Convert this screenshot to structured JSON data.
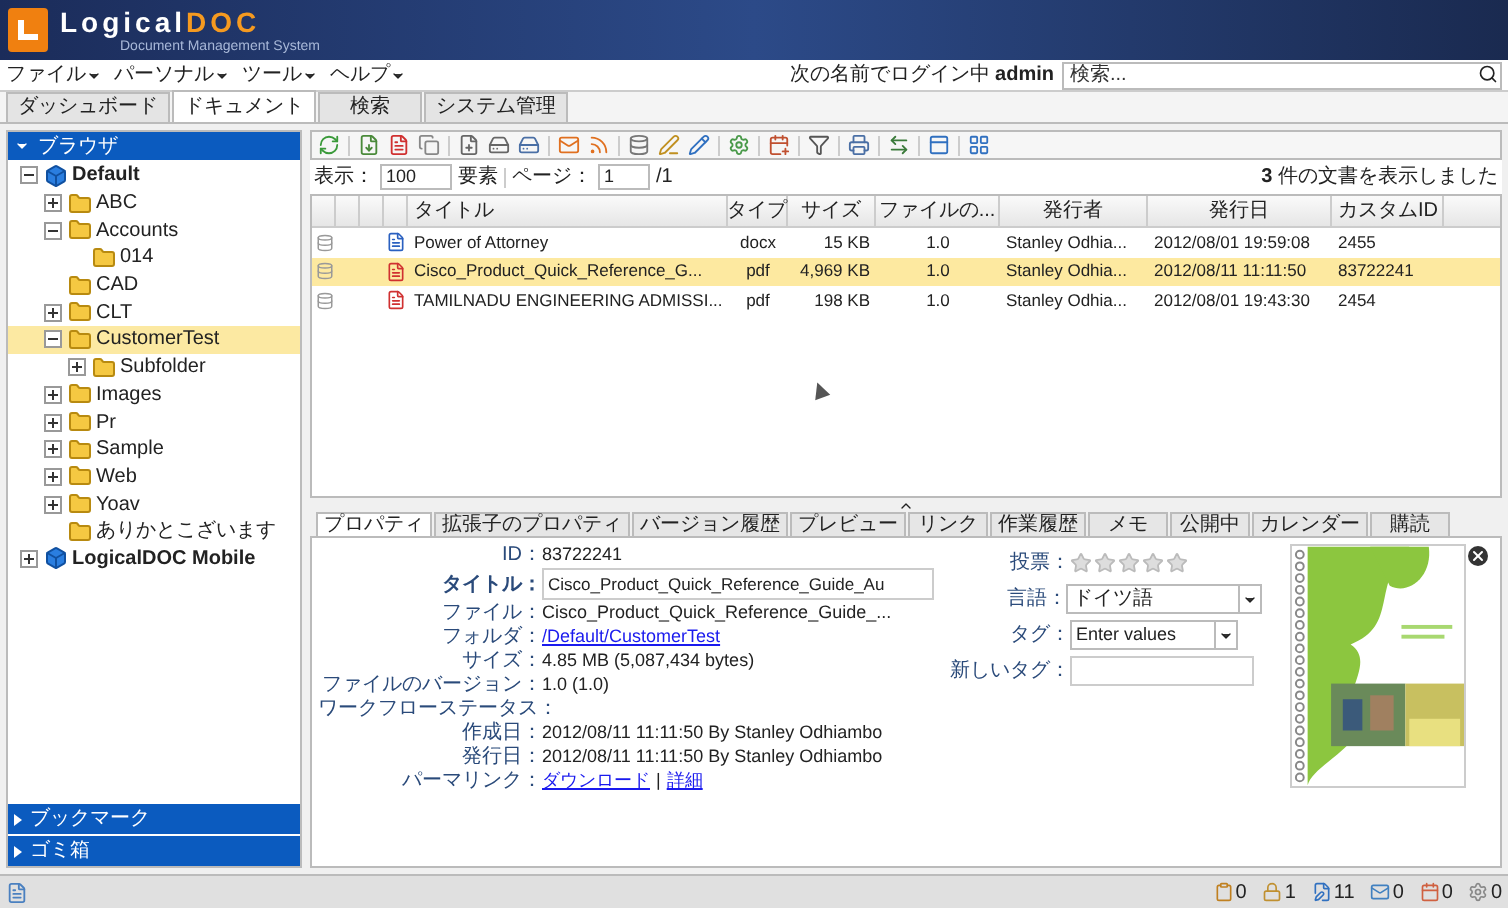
{
  "header": {
    "logo_main": "Logical",
    "logo_accent": "DOC",
    "subtitle": "Document Management System"
  },
  "menus": [
    {
      "label": "ファイル"
    },
    {
      "label": "パーソナル"
    },
    {
      "label": "ツール"
    },
    {
      "label": "ヘルプ"
    }
  ],
  "login": {
    "prefix": "次の名前でログイン中",
    "user": "admin"
  },
  "search": {
    "placeholder": "検索..."
  },
  "main_tabs": [
    {
      "label": "ダッシュボード",
      "selected": false
    },
    {
      "label": "ドキュメント",
      "selected": true
    },
    {
      "label": "検索",
      "selected": false
    },
    {
      "label": "システム管理",
      "selected": false
    }
  ],
  "browser": {
    "title": "ブラウザ",
    "tree": [
      {
        "label": "Default",
        "kind": "workspace",
        "expanded": true,
        "selected": false,
        "children": [
          {
            "label": "ABC",
            "kind": "folder",
            "expanded": false,
            "selected": false
          },
          {
            "label": "Accounts",
            "kind": "folder",
            "expanded": true,
            "selected": false,
            "children": [
              {
                "label": "014",
                "kind": "folder",
                "selected": false
              }
            ]
          },
          {
            "label": "CAD",
            "kind": "folder",
            "selected": false
          },
          {
            "label": "CLT",
            "kind": "folder",
            "expanded": false,
            "selected": false
          },
          {
            "label": "CustomerTest",
            "kind": "folder",
            "expanded": true,
            "selected": true,
            "children": [
              {
                "label": "Subfolder",
                "kind": "folder",
                "expanded": false,
                "selected": false
              }
            ]
          },
          {
            "label": "Images",
            "kind": "folder",
            "expanded": false,
            "selected": false
          },
          {
            "label": "Pr",
            "kind": "folder",
            "expanded": false,
            "selected": false
          },
          {
            "label": "Sample",
            "kind": "folder",
            "expanded": false,
            "selected": false
          },
          {
            "label": "Web",
            "kind": "folder",
            "expanded": false,
            "selected": false
          },
          {
            "label": "Yoav",
            "kind": "folder",
            "expanded": false,
            "selected": false
          },
          {
            "label": "ありかとこざいます",
            "kind": "folder",
            "selected": false
          }
        ]
      },
      {
        "label": "LogicalDOC Mobile",
        "kind": "workspace",
        "expanded": false,
        "selected": false
      }
    ]
  },
  "side_sections": [
    {
      "label": "ブックマーク"
    },
    {
      "label": "ゴミ箱"
    }
  ],
  "pager": {
    "show_label": "表示：",
    "page_size": "100",
    "unit": "要素",
    "page_label": "ページ：",
    "page": "1",
    "total": "/1"
  },
  "result_count": {
    "number": "3",
    "text": "件の文書を表示しました"
  },
  "table": {
    "columns": [
      "タイトル",
      "タイプ",
      "サイズ",
      "ファイルの...",
      "発行者",
      "発行日",
      "カスタムID"
    ],
    "rows": [
      {
        "kind": "docx",
        "selected": false,
        "cells": [
          "Power of Attorney",
          "docx",
          "15 KB",
          "1.0",
          "Stanley Odhia...",
          "2012/08/01 19:59:08",
          "2455"
        ]
      },
      {
        "kind": "pdf",
        "selected": true,
        "cells": [
          "Cisco_Product_Quick_Reference_G...",
          "pdf",
          "4,969 KB",
          "1.0",
          "Stanley Odhia...",
          "2012/08/11 11:11:50",
          "83722241"
        ]
      },
      {
        "kind": "pdf",
        "selected": false,
        "cells": [
          "TAMILNADU ENGINEERING ADMISSI...",
          "pdf",
          "198 KB",
          "1.0",
          "Stanley Odhia...",
          "2012/08/01 19:43:30",
          "2454"
        ]
      }
    ]
  },
  "detail_tabs": [
    {
      "label": "プロパティ",
      "selected": true
    },
    {
      "label": "拡張子のプロパティ",
      "selected": false
    },
    {
      "label": "バージョン履歴",
      "selected": false
    },
    {
      "label": "プレビュー",
      "selected": false
    },
    {
      "label": "リンク",
      "selected": false
    },
    {
      "label": "作業履歴",
      "selected": false
    },
    {
      "label": "メモ",
      "selected": false
    },
    {
      "label": "公開中",
      "selected": false
    },
    {
      "label": "カレンダー",
      "selected": false
    },
    {
      "label": "購読",
      "selected": false
    }
  ],
  "properties": [
    {
      "kind": "text",
      "label": "ID：",
      "value": "83722241"
    },
    {
      "kind": "field",
      "label": "タイトル：",
      "value": "Cisco_Product_Quick_Reference_Guide_Au"
    },
    {
      "kind": "text",
      "label": "ファイル：",
      "value": "Cisco_Product_Quick_Reference_Guide_..."
    },
    {
      "kind": "link",
      "label": "フォルダ：",
      "value": "/Default/CustomerTest"
    },
    {
      "kind": "text",
      "label": "サイズ：",
      "value": "4.85 MB (5,087,434 bytes)"
    },
    {
      "kind": "text",
      "label": "ファイルのバージョン：",
      "value": "1.0 (1.0)"
    },
    {
      "kind": "text",
      "label": "ワークフローステータス："
    },
    {
      "kind": "text",
      "label": "作成日：",
      "value": "2012/08/11 11:11:50 By Stanley Odhiambo"
    },
    {
      "kind": "text",
      "label": "発行日：",
      "value": "2012/08/11 11:11:50 By Stanley Odhiambo"
    },
    {
      "kind": "links",
      "label": "パーマリンク：",
      "links": [
        "ダウンロード",
        "詳細"
      ],
      "separator": "|"
    }
  ],
  "rating": {
    "label": "投票：",
    "stars": 0
  },
  "language": {
    "label": "言語：",
    "value": "ドイツ語"
  },
  "tags": {
    "label": "タグ：",
    "value": "Enter values"
  },
  "new_tag": {
    "label": "新しいタグ："
  },
  "status_counters": [
    {
      "kind": "clipboard",
      "value": "0"
    },
    {
      "kind": "locked",
      "value": "1"
    },
    {
      "kind": "edited",
      "value": "11"
    },
    {
      "kind": "messages",
      "value": "0"
    },
    {
      "kind": "events",
      "value": "0"
    },
    {
      "kind": "tasks",
      "value": "0"
    }
  ]
}
